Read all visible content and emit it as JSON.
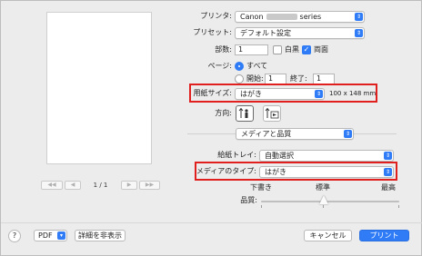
{
  "preview": {
    "page_indicator": "1 / 1",
    "nav_first": "◀◀",
    "nav_prev": "◀",
    "nav_next": "▶",
    "nav_last": "▶▶"
  },
  "printer": {
    "label": "プリンタ:",
    "value_prefix": "Canon",
    "value_suffix": "series"
  },
  "preset": {
    "label": "プリセット:",
    "value": "デフォルト設定"
  },
  "copies": {
    "label": "部数:",
    "value": "1",
    "bw_label": "白黒",
    "duplex_label": "両面",
    "bw_checked": false,
    "duplex_checked": true
  },
  "pages": {
    "label": "ページ:",
    "all_label": "すべて",
    "from_label": "開始:",
    "from_value": "1",
    "to_label": "終了:",
    "to_value": "1"
  },
  "paper_size": {
    "label": "用紙サイズ:",
    "value": "はがき",
    "dimensions": "100 x 148 mm"
  },
  "orientation": {
    "label": "方向:"
  },
  "section": {
    "value": "メディアと品質"
  },
  "tray": {
    "label": "給紙トレイ:",
    "value": "自動選択"
  },
  "media_type": {
    "label": "メディアのタイプ:",
    "value": "はがき"
  },
  "quality": {
    "label": "品質:",
    "low": "下書き",
    "standard": "標準",
    "high": "最高"
  },
  "footer": {
    "help": "?",
    "pdf": "PDF",
    "hide_details": "詳細を非表示",
    "cancel": "キャンセル",
    "print": "プリント"
  },
  "colors": {
    "accent": "#2f7cf6",
    "highlight": "#e0201f"
  }
}
